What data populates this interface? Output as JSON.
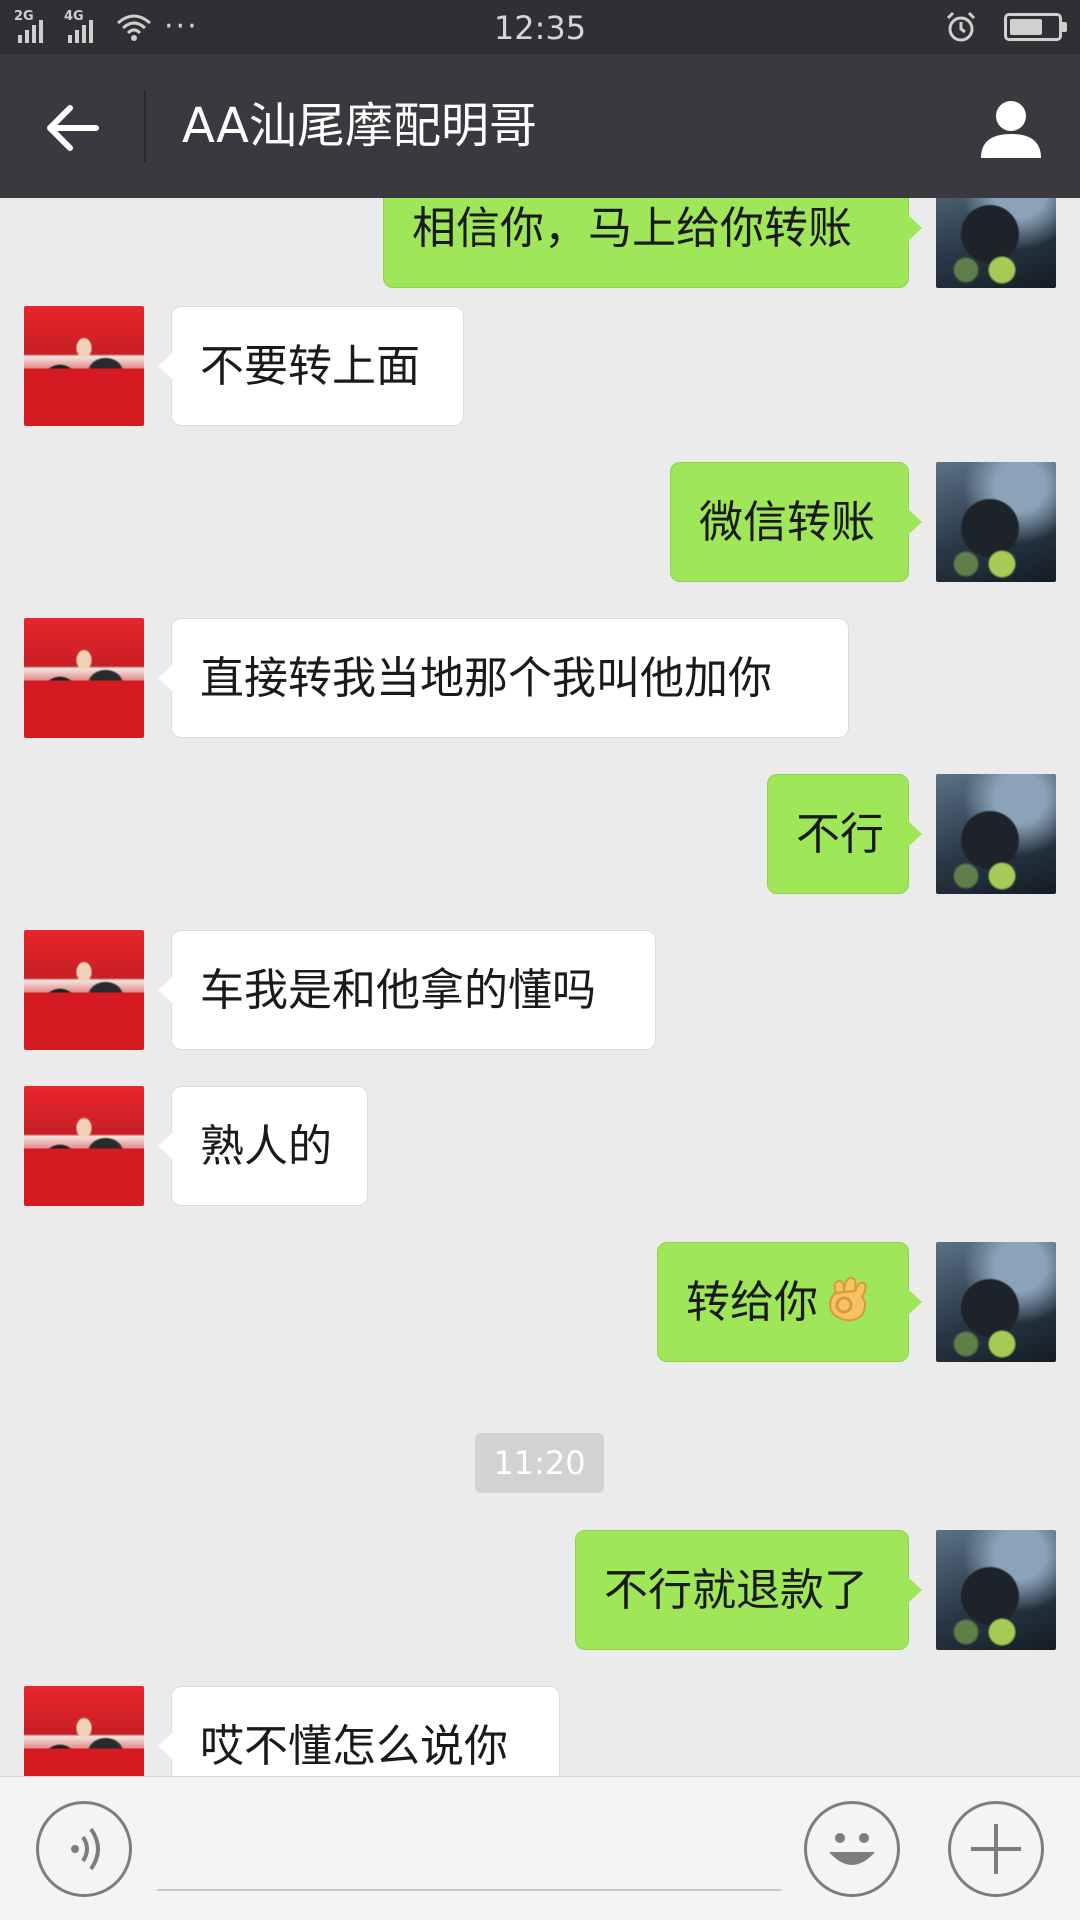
{
  "status_bar": {
    "net_left": "2G",
    "net_right": "4G",
    "more": "···",
    "time": "12:35"
  },
  "header": {
    "title": "AA汕尾摩配明哥"
  },
  "messages": [
    {
      "side": "out",
      "text": "相信你，马上给你转账"
    },
    {
      "side": "in",
      "text": "不要转上面"
    },
    {
      "side": "out",
      "text": "微信转账"
    },
    {
      "side": "in",
      "text": "直接转我当地那个我叫他加你"
    },
    {
      "side": "out",
      "text": "不行"
    },
    {
      "side": "in",
      "text": "车我是和他拿的懂吗"
    },
    {
      "side": "in",
      "text": "熟人的"
    },
    {
      "side": "out",
      "text": "转给你",
      "emoji": "ok-hand"
    },
    {
      "side": "out",
      "text": "不行就退款了"
    },
    {
      "side": "in",
      "text": "哎不懂怎么说你"
    }
  ],
  "timestamp": "11:20",
  "input": {
    "value": "",
    "placeholder": ""
  },
  "colors": {
    "outgoing_bubble": "#9fe658",
    "incoming_bubble": "#ffffff",
    "title_bar": "#393a3f",
    "chat_background": "#ebebeb"
  }
}
